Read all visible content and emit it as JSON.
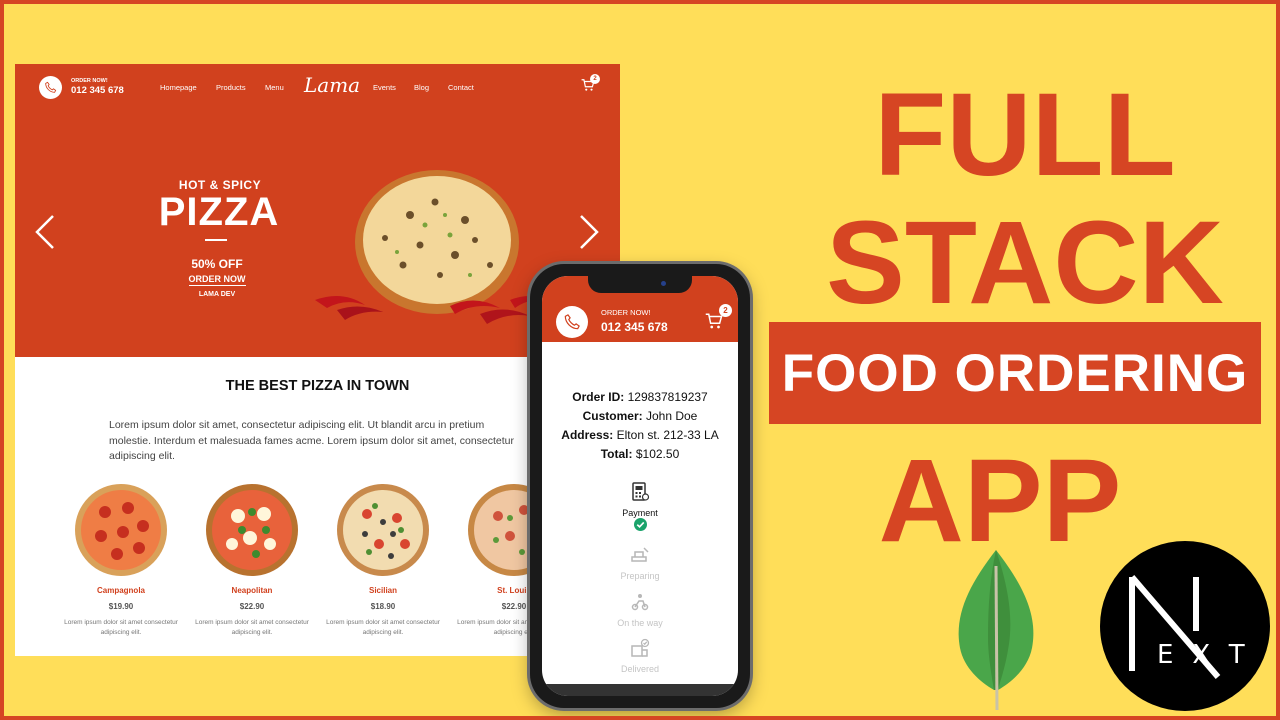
{
  "website": {
    "nav": {
      "order_label": "ORDER NOW!",
      "phone": "012 345 678",
      "links": [
        "Homepage",
        "Products",
        "Menu",
        "Events",
        "Blog",
        "Contact"
      ],
      "logo": "Lama",
      "cart_count": "2"
    },
    "hero": {
      "subtitle": "HOT & SPICY",
      "title": "PIZZA",
      "offer": "50% OFF",
      "cta": "ORDER NOW",
      "brand": "LAMA DEV"
    },
    "section": {
      "title": "THE BEST PIZZA IN TOWN",
      "description": "Lorem ipsum dolor sit amet, consectetur adipiscing elit. Ut blandit arcu in pretium molestie. Interdum et malesuada fames acme. Lorem ipsum dolor sit amet, consectetur adipiscing elit."
    },
    "products": [
      {
        "name": "Campagnola",
        "price": "$19.90",
        "desc": "Lorem ipsum dolor sit amet consectetur adipiscing elit."
      },
      {
        "name": "Neapolitan",
        "price": "$22.90",
        "desc": "Lorem ipsum dolor sit amet consectetur adipiscing elit."
      },
      {
        "name": "Sicilian",
        "price": "$18.90",
        "desc": "Lorem ipsum dolor sit amet consectetur adipiscing elit."
      },
      {
        "name": "St. Louis",
        "price": "$22.90",
        "desc": "Lorem ipsum dolor sit amet consectetur adipiscing elit."
      }
    ]
  },
  "phone_app": {
    "order_label": "ORDER NOW!",
    "phone": "012 345 678",
    "cart_count": "2",
    "order": {
      "id_label": "Order ID:",
      "id": "129837819237",
      "customer_label": "Customer:",
      "customer": "John Doe",
      "address_label": "Address:",
      "address": "Elton st. 212-33 LA",
      "total_label": "Total:",
      "total": "$102.50"
    },
    "steps": [
      "Payment",
      "Preparing",
      "On the way",
      "Delivered"
    ]
  },
  "headline": {
    "line1": "FULL",
    "line2": "STACK",
    "line3": "FOOD ORDERING",
    "line4": "APP"
  },
  "logos": {
    "next_letters": "EXT"
  },
  "colors": {
    "background": "#ffde59",
    "brand_red": "#d1411e",
    "headline_red": "#d64523"
  }
}
